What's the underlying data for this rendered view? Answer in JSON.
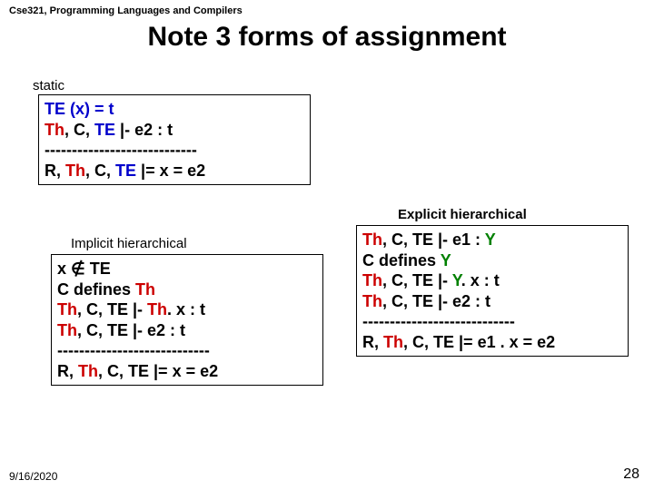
{
  "course_header": "Cse321, Programming Languages and Compilers",
  "title": "Note 3 forms of assignment",
  "labels": {
    "static": "static",
    "implicit": "Implicit hierarchical",
    "explicit": "Explicit hierarchical"
  },
  "static_box": {
    "l1_pre": "TE (x) = t",
    "l2_a": "Th",
    "l2_b": ", C, ",
    "l2_c": "TE",
    "l2_d": " |-  e2 : t",
    "sep": "----------------------------",
    "l4_a": "R, ",
    "l4_b": "Th",
    "l4_c": ", C, ",
    "l4_d": "TE",
    "l4_e": " |=  x = e2"
  },
  "implicit_box": {
    "l1": "x ∉ TE",
    "l2_a": "C defines ",
    "l2_b": "Th",
    "l3_a": "Th",
    "l3_b": ", C, TE |-  ",
    "l3_c": "Th",
    "l3_d": ". x : t",
    "l4_a": "Th",
    "l4_b": ", C, TE |-  e2 : t",
    "sep": "----------------------------",
    "l6_a": "R, ",
    "l6_b": "Th",
    "l6_c": ", C, TE |=  x = e2"
  },
  "explicit_box": {
    "l1_a": "Th",
    "l1_b": ", C, TE |-  e1  : ",
    "l1_c": "Y",
    "l2_a": "C defines ",
    "l2_b": "Y",
    "l3_a": "Th",
    "l3_b": ", C, TE |-  ",
    "l3_c": "Y",
    "l3_d": ". x : t",
    "l4_a": "Th",
    "l4_b": ", C, TE |-  e2 : t",
    "sep": "----------------------------",
    "l6_a": "R, ",
    "l6_b": "Th",
    "l6_c": ", C, TE |=  e1 . x = e2"
  },
  "footer": {
    "date": "9/16/2020",
    "page": "28"
  }
}
